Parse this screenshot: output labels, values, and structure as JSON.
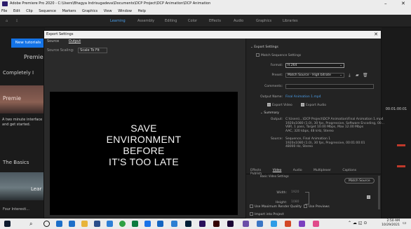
{
  "window": {
    "title": "Adobe Premiere Pro 2020 - C:\\Users\\Bhagya Indrisugadeva\\Documents\\DCP Project\\DCP Animation\\DCP Animation",
    "minimize": "–",
    "close": "✕"
  },
  "menu": [
    "File",
    "Edit",
    "Clip",
    "Sequence",
    "Markers",
    "Graphics",
    "View",
    "Window",
    "Help"
  ],
  "workspaces": [
    "Learning",
    "Assembly",
    "Editing",
    "Color",
    "Effects",
    "Audio",
    "Graphics",
    "Libraries"
  ],
  "active_workspace": "Learning",
  "learn_panel": {
    "button": "New tutorials",
    "heading1": "Premie",
    "heading2": "Completely I",
    "thumb_label": "Premie",
    "desc": "A two minute interface and get started.",
    "heading3": "The Basics",
    "thumb2_label": "Lear",
    "footer": "Four Interesti..."
  },
  "right_timecode": "00:01:00:01",
  "dialog": {
    "title": "Export Settings",
    "close": "✕",
    "source_tabs": [
      "Source",
      "Output"
    ],
    "active_source_tab": "Output",
    "source_scaling_label": "Source Scaling:",
    "source_scaling_value": "Scale To Fit",
    "preview_lines": [
      "SAVE",
      "ENVIRONMENT",
      "BEFORE",
      "IT'S TOO LATE"
    ]
  },
  "export": {
    "section_title": "Export Settings",
    "match_sequence": "Match Sequence Settings",
    "format_label": "Format:",
    "format_value": "H.264",
    "preset_label": "Preset:",
    "preset_value": "Match Source - High bitrate",
    "comments_label": "Comments:",
    "output_name_label": "Output Name:",
    "output_name_value": "Final Animation 1.mp4",
    "export_video": "Export Video",
    "export_audio": "Export Audio",
    "summary_title": "Summary",
    "output_label": "Output:",
    "output_lines": [
      "C:\\Users\\...\\DCP Project\\DCP Animation\\Final Animation 1.mp4",
      "1920x1080 (1.0), 30 fps, Progressive, Software Encoding, 00...",
      "VBR, 1 pass, Target 10.00 Mbps, Max 12.00 Mbps",
      "AAC, 320 kbps, 48 kHz, Stereo"
    ],
    "source_label": "Source:",
    "source_lines": [
      "Sequence, Final Animation 1",
      "1920x1080 (1.0), 30 fps, Progressive, 00:01:00:01",
      "48000 Hz, Stereo"
    ],
    "tabs": [
      "Effects",
      "Video",
      "Audio",
      "Multiplexer",
      "Captions",
      "Publish"
    ],
    "active_tab": "Video",
    "basic_video": "Basic Video Settings",
    "match_source_btn": "Match Source",
    "width_label": "Width:",
    "width_value": "1920",
    "height_label": "Height:",
    "height_value": "1080",
    "max_render": "Use Maximum Render Quality",
    "use_previews": "Use Previews",
    "import_project": "Import into Project"
  },
  "clock": {
    "time": "2:50 AM",
    "date": "10/29/2021"
  },
  "colors": {
    "accent": "#1473e6",
    "link": "#4b9fea",
    "dialog_bg": "#2a2a2a"
  }
}
